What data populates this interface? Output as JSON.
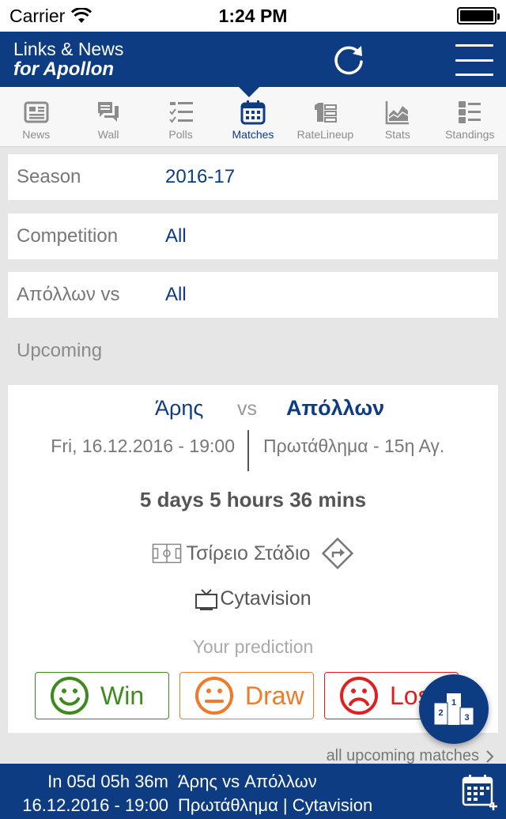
{
  "status_bar": {
    "carrier": "Carrier",
    "time": "1:24 PM",
    "battery_level": 1.0
  },
  "header": {
    "title_line1": "Links & News",
    "title_line2": "for Apollon"
  },
  "tabs": [
    {
      "label": "News",
      "icon": "newspaper-icon"
    },
    {
      "label": "Wall",
      "icon": "chat-bubbles-icon"
    },
    {
      "label": "Polls",
      "icon": "checklist-icon"
    },
    {
      "label": "Matches",
      "icon": "calendar-icon",
      "active": true
    },
    {
      "label": "RateLineup",
      "icon": "jersey-list-icon"
    },
    {
      "label": "Stats",
      "icon": "area-chart-icon"
    },
    {
      "label": "Standings",
      "icon": "numbered-list-icon"
    }
  ],
  "filters": {
    "season": {
      "label": "Season",
      "value": "2016-17"
    },
    "competition": {
      "label": "Competition",
      "value": "All"
    },
    "opponent": {
      "label": "Απόλλων vs",
      "value": "All"
    }
  },
  "upcoming": {
    "section_title": "Upcoming",
    "home_team": "Άρης",
    "vs": "vs",
    "away_team": "Απόλλων",
    "date": "Fri, 16.12.2016 - 19:00",
    "competition_round": "Πρωτάθλημα - 15η Αγ.",
    "countdown": "5 days  5 hours  36 mins",
    "venue": "Τσίρειο Στάδιο",
    "tv": "Cytavision",
    "prediction_title": "Your prediction",
    "predictions": {
      "win": "Win",
      "draw": "Draw",
      "lose": "Lose"
    },
    "all_link": "all upcoming matches"
  },
  "bottom_bar": {
    "countdown": "In 05d 05h 36m",
    "date": "16.12.2016 - 19:00",
    "teams": "Άρης vs Απόλλων",
    "info": "Πρωτάθλημα | Cytavision"
  },
  "colors": {
    "brand": "#0d3c82",
    "win": "#3e8a1f",
    "draw": "#ee7a2a",
    "lose": "#e02020"
  }
}
